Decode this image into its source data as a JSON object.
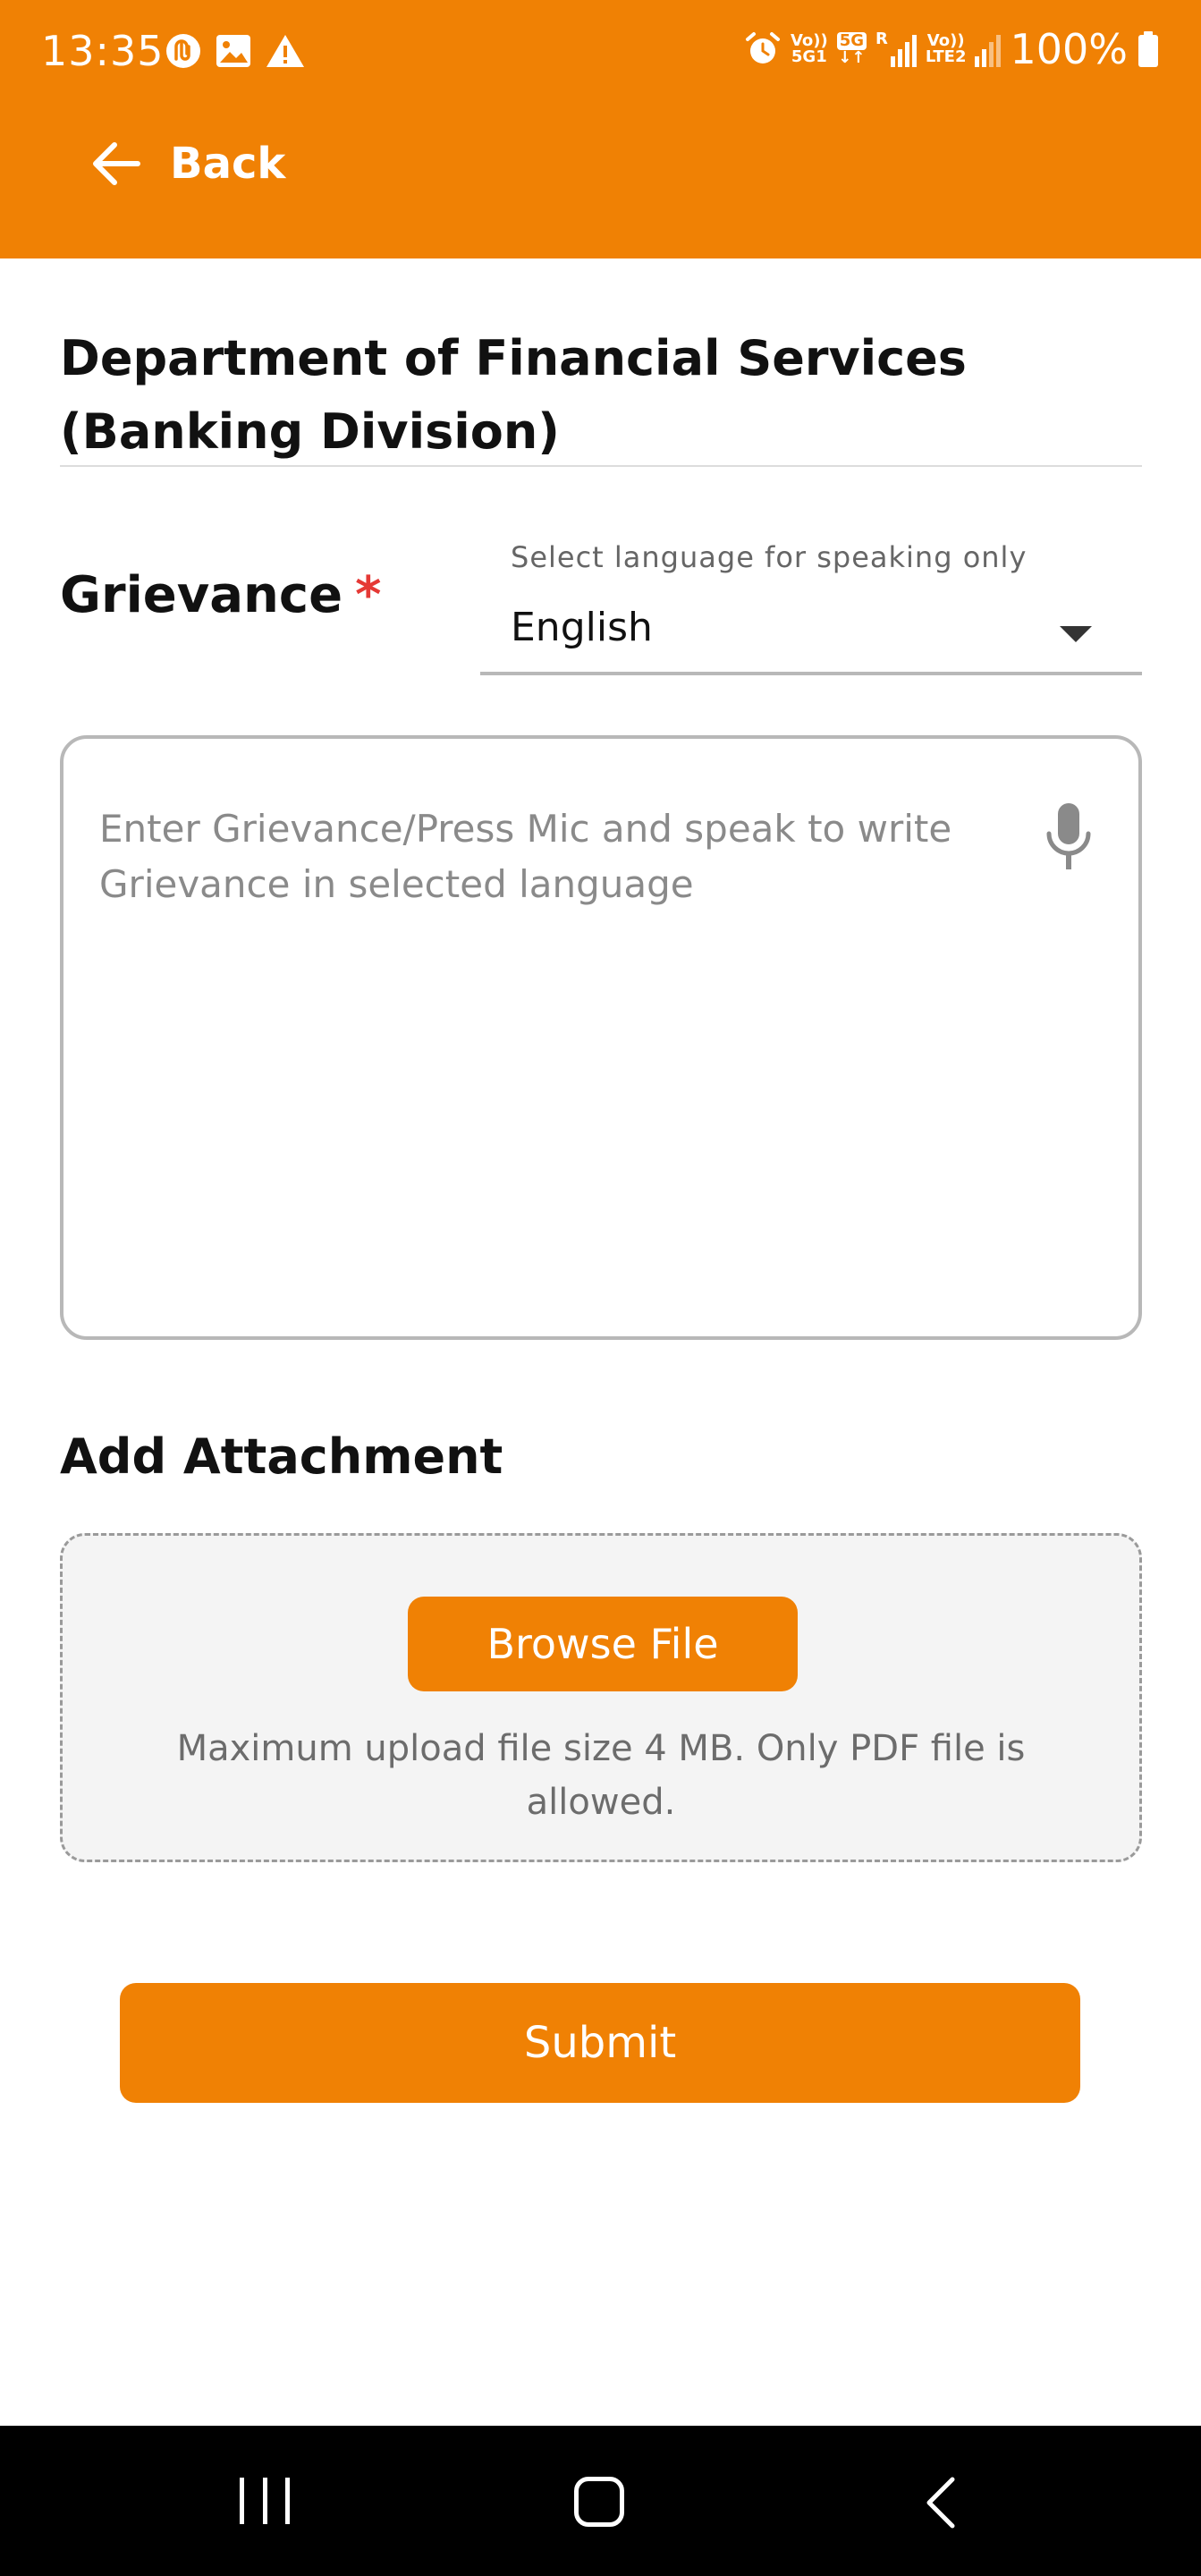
{
  "status_bar": {
    "time": "13:35",
    "battery": "100%",
    "net1_top": "Vo))",
    "net1_bottom": "5G1",
    "net_5g": "5G",
    "net2_top": "Vo))",
    "net2_bottom": "LTE2",
    "roaming": "R"
  },
  "header": {
    "back_label": "Back"
  },
  "form": {
    "department": "Department of Financial Services (Banking Division)",
    "grievance_label": "Grievance",
    "required_mark": "*",
    "language_caption": "Select language for speaking only",
    "language_value": "English",
    "grievance_placeholder": "Enter Grievance/Press Mic and speak to write Grievance in selected language"
  },
  "attachment": {
    "title": "Add Attachment",
    "browse_label": "Browse File",
    "note": "Maximum upload file size 4 MB. Only PDF file is allowed."
  },
  "actions": {
    "submit_label": "Submit"
  },
  "colors": {
    "accent": "#f08104",
    "required": "#e53935"
  }
}
